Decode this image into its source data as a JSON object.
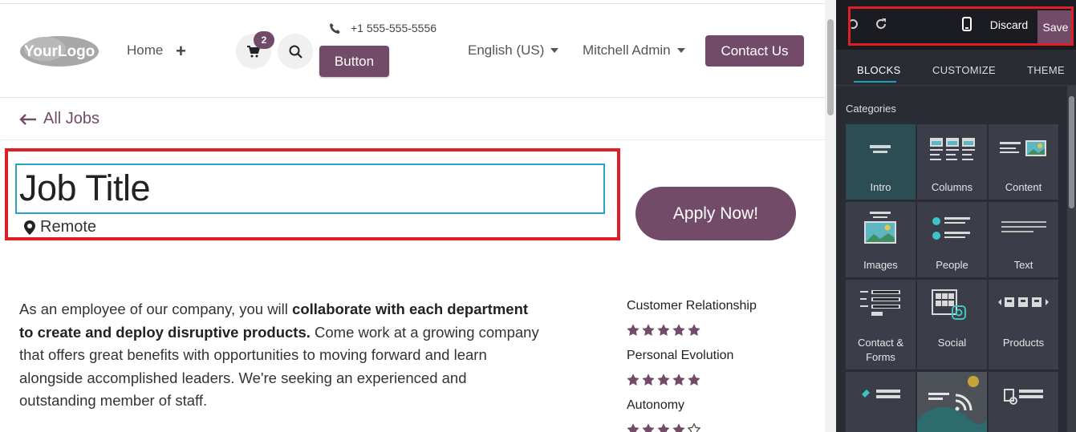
{
  "header": {
    "logo_text": "YourLogo",
    "nav_home": "Home",
    "nav_add": "+",
    "cart_count": "2",
    "phone": "+1 555-555-5556",
    "button_label": "Button",
    "language": "English (US)",
    "user": "Mitchell Admin",
    "contact_label": "Contact Us"
  },
  "breadcrumb": {
    "back_label": "All Jobs"
  },
  "job": {
    "title": "Job Title",
    "location": "Remote",
    "apply_label": "Apply Now!",
    "description_parts": [
      "As an employee of our company, you will ",
      "collaborate with each department to create and deploy disruptive products.",
      " Come work at a growing company that offers great benefits with opportunities to moving forward and learn alongside accomplished leaders. We're seeking an experienced and outstanding member of staff."
    ]
  },
  "skills": [
    {
      "label": "Customer Relationship",
      "rating": 5,
      "max": 5
    },
    {
      "label": "Personal Evolution",
      "rating": 5,
      "max": 5
    },
    {
      "label": "Autonomy",
      "rating": 4,
      "max": 5
    }
  ],
  "editor": {
    "discard_label": "Discard",
    "save_label": "Save",
    "tabs": [
      "BLOCKS",
      "CUSTOMIZE",
      "THEME"
    ],
    "categories_label": "Categories",
    "blocks": [
      {
        "label": "Intro",
        "icon": "intro-icon"
      },
      {
        "label": "Columns",
        "icon": "columns-icon"
      },
      {
        "label": "Content",
        "icon": "content-icon"
      },
      {
        "label": "Images",
        "icon": "images-icon"
      },
      {
        "label": "People",
        "icon": "people-icon"
      },
      {
        "label": "Text",
        "icon": "text-icon"
      },
      {
        "label": "Contact & Forms",
        "icon": "contact-forms-icon"
      },
      {
        "label": "Social",
        "icon": "social-icon"
      },
      {
        "label": "Products",
        "icon": "products-icon"
      }
    ]
  },
  "colors": {
    "brand": "#714b67",
    "highlight_red": "#e01e26",
    "focus_cyan": "#24a3c9",
    "editor_bg": "#2a2c34"
  }
}
